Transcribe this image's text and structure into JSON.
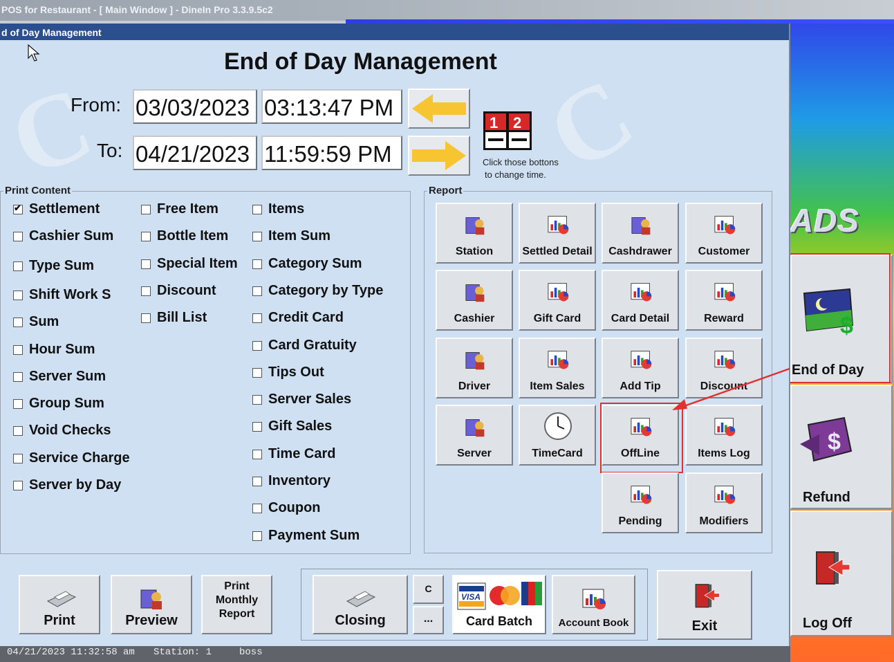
{
  "window": {
    "title": "POS for Restaurant - [ Main Window ] - DineIn Pro 3.3.9.5c2"
  },
  "subwindow": {
    "title": "d of Day Management"
  },
  "header": {
    "title": "End of Day Management"
  },
  "range": {
    "from_label": "From:",
    "from_date": "03/03/2023",
    "from_time": "03:13:47 PM",
    "to_label": "To:",
    "to_date": "04/21/2023",
    "to_time": "11:59:59 PM",
    "hint_line1": "Click those bottons",
    "hint_line2": "to change time."
  },
  "print_content": {
    "legend": "Print Content",
    "col1": [
      {
        "label": "Settlement",
        "checked": true
      },
      {
        "label": "Cashier Sum",
        "checked": false
      },
      {
        "label": "Type Sum",
        "checked": false
      },
      {
        "label": "Shift Work S",
        "checked": false
      },
      {
        "label": "Sum",
        "checked": false
      },
      {
        "label": "Hour Sum",
        "checked": false
      },
      {
        "label": "Server Sum",
        "checked": false
      },
      {
        "label": "Group Sum",
        "checked": false
      },
      {
        "label": "Void Checks",
        "checked": false
      },
      {
        "label": "Service Charge",
        "checked": false
      },
      {
        "label": "Server by Day",
        "checked": false
      }
    ],
    "col2": [
      {
        "label": "Free Item",
        "checked": false
      },
      {
        "label": "Bottle Item",
        "checked": false
      },
      {
        "label": "Special Item",
        "checked": false
      },
      {
        "label": "Discount",
        "checked": false
      },
      {
        "label": "Bill List",
        "checked": false
      }
    ],
    "col3": [
      {
        "label": "Items",
        "checked": false
      },
      {
        "label": "Item Sum",
        "checked": false
      },
      {
        "label": "Category Sum",
        "checked": false
      },
      {
        "label": "Category by Type",
        "checked": false
      },
      {
        "label": "Credit Card",
        "checked": false
      },
      {
        "label": "Card Gratuity",
        "checked": false
      },
      {
        "label": "Tips Out",
        "checked": false
      },
      {
        "label": "Server Sales",
        "checked": false
      },
      {
        "label": "Gift Sales",
        "checked": false
      },
      {
        "label": "Time Card",
        "checked": false
      },
      {
        "label": "Inventory",
        "checked": false
      },
      {
        "label": "Coupon",
        "checked": false
      },
      {
        "label": "Payment Sum",
        "checked": false
      }
    ]
  },
  "report": {
    "legend": "Report",
    "buttons": [
      {
        "label": "Station",
        "icon": "person-report-icon"
      },
      {
        "label": "Settled Detail",
        "icon": "chart-icon"
      },
      {
        "label": "Cashdrawer",
        "icon": "person-report-icon"
      },
      {
        "label": "Customer",
        "icon": "chart-icon"
      },
      {
        "label": "Cashier",
        "icon": "person-report-icon"
      },
      {
        "label": "Gift Card",
        "icon": "chart-icon"
      },
      {
        "label": "Card Detail",
        "icon": "chart-icon"
      },
      {
        "label": "Reward",
        "icon": "chart-icon"
      },
      {
        "label": "Driver",
        "icon": "person-report-icon"
      },
      {
        "label": "Item Sales",
        "icon": "chart-icon"
      },
      {
        "label": "Add Tip",
        "icon": "chart-icon"
      },
      {
        "label": "Discount",
        "icon": "chart-icon"
      },
      {
        "label": "Server",
        "icon": "person-report-icon"
      },
      {
        "label": "TimeCard",
        "icon": "clock-icon"
      },
      {
        "label": "OffLine",
        "icon": "chart-icon"
      },
      {
        "label": "Items Log",
        "icon": "chart-icon"
      },
      {
        "label": "Pending",
        "icon": "chart-icon"
      },
      {
        "label": "Modifiers",
        "icon": "chart-icon"
      }
    ]
  },
  "bottom": {
    "print": "Print",
    "preview": "Preview",
    "monthly_1": "Print",
    "monthly_2": "Monthly",
    "monthly_3": "Report",
    "closing": "Closing",
    "c": "C",
    "dots": "...",
    "card_batch": "Card Batch",
    "account_book": "Account Book",
    "exit": "Exit"
  },
  "side": {
    "ads": "ADS",
    "end_of_day": "End of Day",
    "refund": "Refund",
    "log_off": "Log Off"
  },
  "status": {
    "datetime": "04/21/2023 11:32:58 am",
    "station": "Station: 1",
    "user": "boss"
  },
  "colors": {
    "accent_red": "#e03030",
    "panel": "#cfe0f2",
    "arrow_yellow": "#f7c531"
  }
}
